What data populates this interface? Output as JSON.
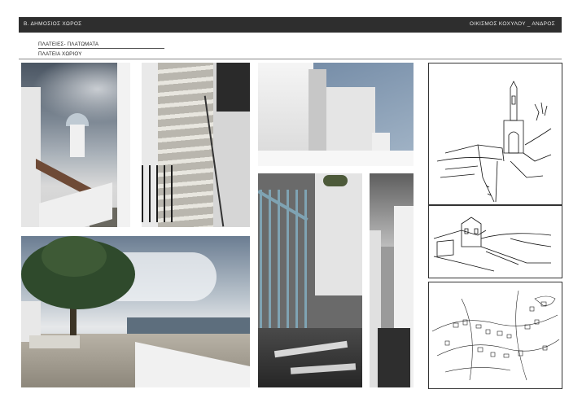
{
  "header": {
    "left_title": "Β. ΔΗΜΟΣΙΟΣ ΧΩΡΟΣ",
    "right_title": "ΟΙΚΙΣΜΟΣ ΚΟΧΥΛΟΥ _ ΑΝΔΡΟΣ"
  },
  "subtitles": {
    "line1": "ΠΛΑΤΕΙΕΣ- ΠΛΑΤΩΜΑΤΑ",
    "line2": "ΠΛΑΤΕΙΑ ΧΩΡΙΟΥ"
  },
  "colors": {
    "header_bar": "#2e2e2e",
    "header_text": "#e8e8e8"
  }
}
